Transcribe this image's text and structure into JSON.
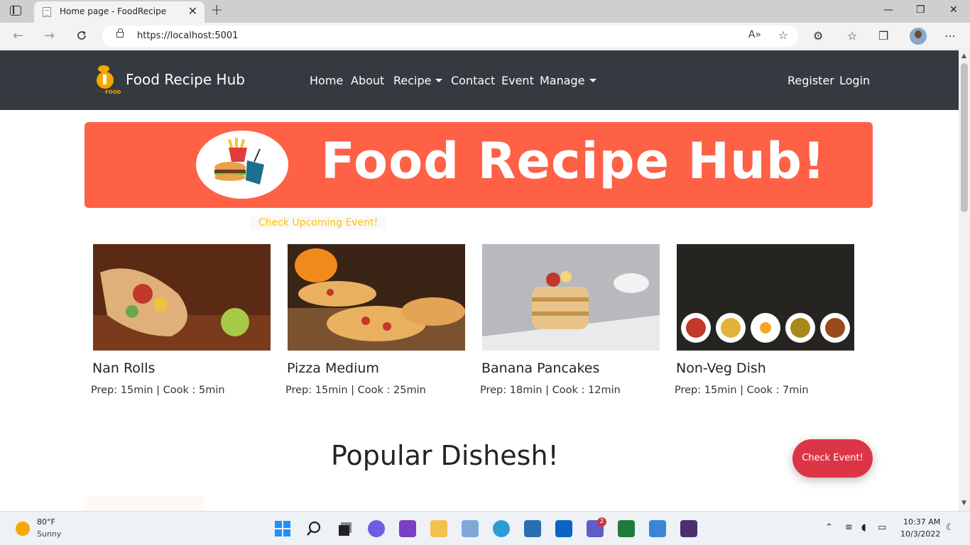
{
  "browser": {
    "tab_title": "Home page - FoodRecipe",
    "url": "https://localhost:5001",
    "new_tab": "+",
    "close_tab": "✕",
    "window_min": "—",
    "window_max": "❐",
    "window_close": "✕"
  },
  "site": {
    "brand": "Food Recipe Hub",
    "logo_text": "FOOD",
    "nav": {
      "home": "Home",
      "about": "About",
      "recipe": "Recipe",
      "contact": "Contact",
      "event": "Event",
      "manage": "Manage",
      "register": "Register",
      "login": "Login"
    },
    "hero_title": "Food Recipe Hub!",
    "event_link": "Check Upcoming Event!",
    "cards": [
      {
        "title": "Nan Rolls",
        "meta": "Prep: 15min | Cook : 5min"
      },
      {
        "title": "Pizza Medium",
        "meta": "Prep: 15min | Cook : 25min"
      },
      {
        "title": "Banana Pancakes",
        "meta": "Prep: 18min | Cook : 12min"
      },
      {
        "title": "Non-Veg Dish",
        "meta": "Prep: 15min | Cook : 7min"
      }
    ],
    "popular_heading": "Popular Dishesh!",
    "check_event_button": "Check Event!",
    "colors": {
      "navbar": "#343a40",
      "hero": "#fe6146",
      "event_link": "#ffc107",
      "button": "#dc3545"
    }
  },
  "taskbar": {
    "weather_temp": "80°F",
    "weather_desc": "Sunny",
    "time": "10:37 AM",
    "date": "10/3/2022",
    "teams_badge": "2"
  }
}
